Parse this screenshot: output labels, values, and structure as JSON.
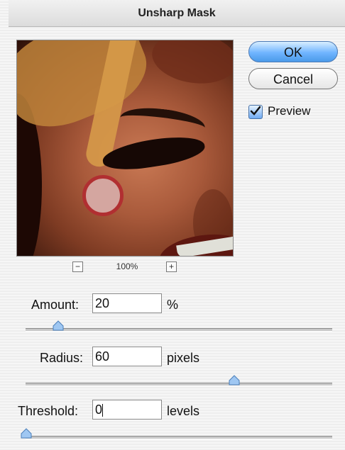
{
  "window": {
    "title": "Unsharp Mask"
  },
  "zoom": {
    "label": "100%",
    "decrease_icon": "minus-box-icon",
    "increase_icon": "plus-box-icon"
  },
  "buttons": {
    "ok": "OK",
    "cancel": "Cancel"
  },
  "preview": {
    "label": "Preview",
    "checked": true
  },
  "fields": {
    "amount": {
      "label": "Amount:",
      "value": "20",
      "unit": "%"
    },
    "radius": {
      "label": "Radius:",
      "value": "60",
      "unit": "pixels"
    },
    "threshold": {
      "label": "Threshold:",
      "value": "0",
      "unit": "levels"
    }
  },
  "colors": {
    "accent": "#4a9ae9",
    "dialog_bg": "#f4f4f4",
    "thumb": "#9fc7f2"
  },
  "sliders": {
    "amount_fraction": 0.11,
    "radius_fraction": 0.68,
    "threshold_fraction": 0.0
  }
}
